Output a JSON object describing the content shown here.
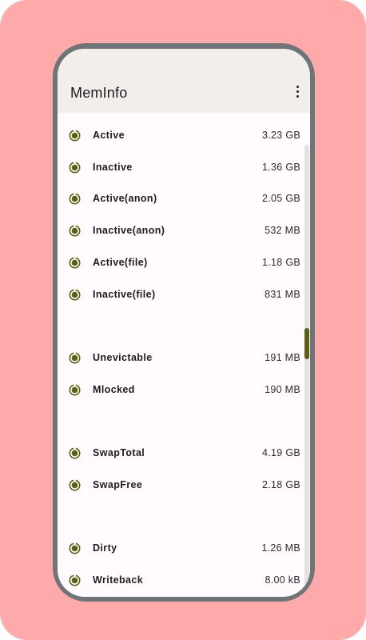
{
  "app": {
    "title": "MemInfo",
    "menu_icon": "more-vert-icon",
    "item_icon": "radio-circle-icon"
  },
  "colors": {
    "background": "#FFAAAA",
    "frame": "#6F7476",
    "appbar": "#F1EEEB",
    "accent": "#5C5F0F"
  },
  "memory": [
    {
      "label": "Active",
      "value": "3.23 GB"
    },
    {
      "label": "Inactive",
      "value": "1.36 GB"
    },
    {
      "label": "Active(anon)",
      "value": "2.05 GB"
    },
    {
      "label": "Inactive(anon)",
      "value": "532 MB"
    },
    {
      "label": "Active(file)",
      "value": "1.18 GB"
    },
    {
      "label": "Inactive(file)",
      "value": "831 MB"
    },
    {
      "label": "Unevictable",
      "value": "191 MB"
    },
    {
      "label": "Mlocked",
      "value": "190 MB"
    },
    {
      "label": "SwapTotal",
      "value": "4.19 GB"
    },
    {
      "label": "SwapFree",
      "value": "2.18 GB"
    },
    {
      "label": "Dirty",
      "value": "1.26 MB"
    },
    {
      "label": "Writeback",
      "value": "8.00 kB"
    }
  ]
}
